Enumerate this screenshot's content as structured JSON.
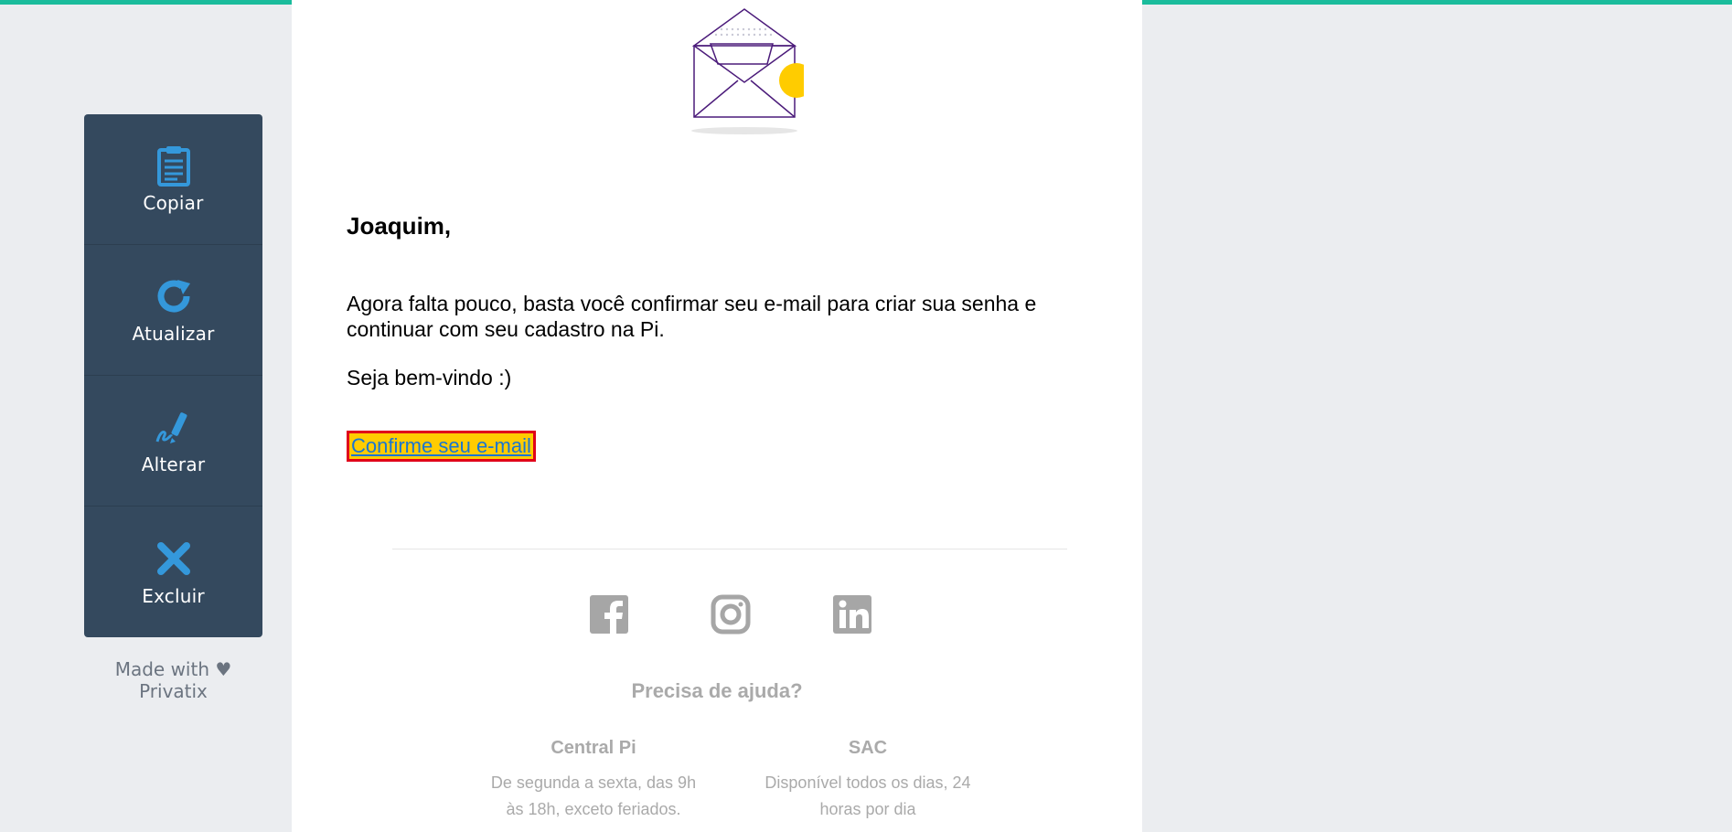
{
  "toolbar": {
    "items": [
      {
        "label": "Copiar",
        "icon": "clipboard-icon"
      },
      {
        "label": "Atualizar",
        "icon": "refresh-icon"
      },
      {
        "label": "Alterar",
        "icon": "edit-pen-icon"
      },
      {
        "label": "Excluir",
        "icon": "close-icon"
      }
    ],
    "made_with": "Made with ♥ Privatix"
  },
  "email": {
    "greeting": "Joaquim,",
    "body": "Agora falta pouco, basta você confirmar seu e-mail para criar sua senha e continuar com seu cadastro na Pi.",
    "welcome": "Seja bem-vindo :)",
    "cta_label": "Confirme seu e-mail",
    "social_icons": [
      "facebook-icon",
      "instagram-icon",
      "linkedin-icon"
    ],
    "help_title": "Precisa de ajuda?",
    "help_columns": [
      {
        "title": "Central Pi",
        "desc": "De segunda a sexta, das 9h às 18h, exceto feriados."
      },
      {
        "title": "SAC",
        "desc": "Disponível todos os dias, 24 horas por dia"
      }
    ]
  },
  "colors": {
    "accent_top": "#1abc9c",
    "toolbar_bg": "#34495e",
    "toolbar_icon": "#3498db",
    "cta_bg": "#ffcc00",
    "cta_border": "#e0001a",
    "envelope_stroke": "#4b1b7a",
    "envelope_dot": "#ffcc00"
  }
}
